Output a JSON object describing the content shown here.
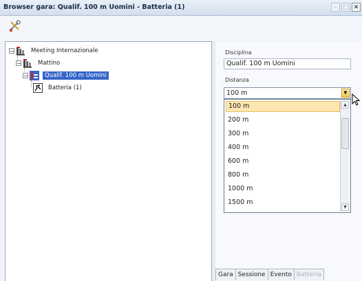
{
  "window": {
    "title": "Browser gara: Qualif. 100 m Uomini - Batteria (1)"
  },
  "toolbar": {
    "icon": "tools-icon"
  },
  "tree": {
    "nodes": [
      {
        "label": "Meeting Internazionale",
        "expander": "−"
      },
      {
        "label": "Mattino",
        "expander": "−"
      },
      {
        "label": "Qualif. 100 m Uomini",
        "expander": "−",
        "selected": true
      },
      {
        "label": "Batteria (1)"
      }
    ]
  },
  "details": {
    "disciplina_label": "Disciplina",
    "disciplina_value": "Qualif. 100 m Uomini",
    "distanza_label": "Distanza",
    "distanza_value": "100 m",
    "options": [
      "100 m",
      "200 m",
      "300 m",
      "400 m",
      "600 m",
      "800 m",
      "1000 m",
      "1500 m"
    ]
  },
  "tabs": [
    {
      "label": "Gara"
    },
    {
      "label": "Sessione"
    },
    {
      "label": "Evento"
    },
    {
      "label": "Batteria",
      "disabled": true
    }
  ],
  "colors": {
    "selection": "#3565c9",
    "hover": "#fde7b0"
  }
}
